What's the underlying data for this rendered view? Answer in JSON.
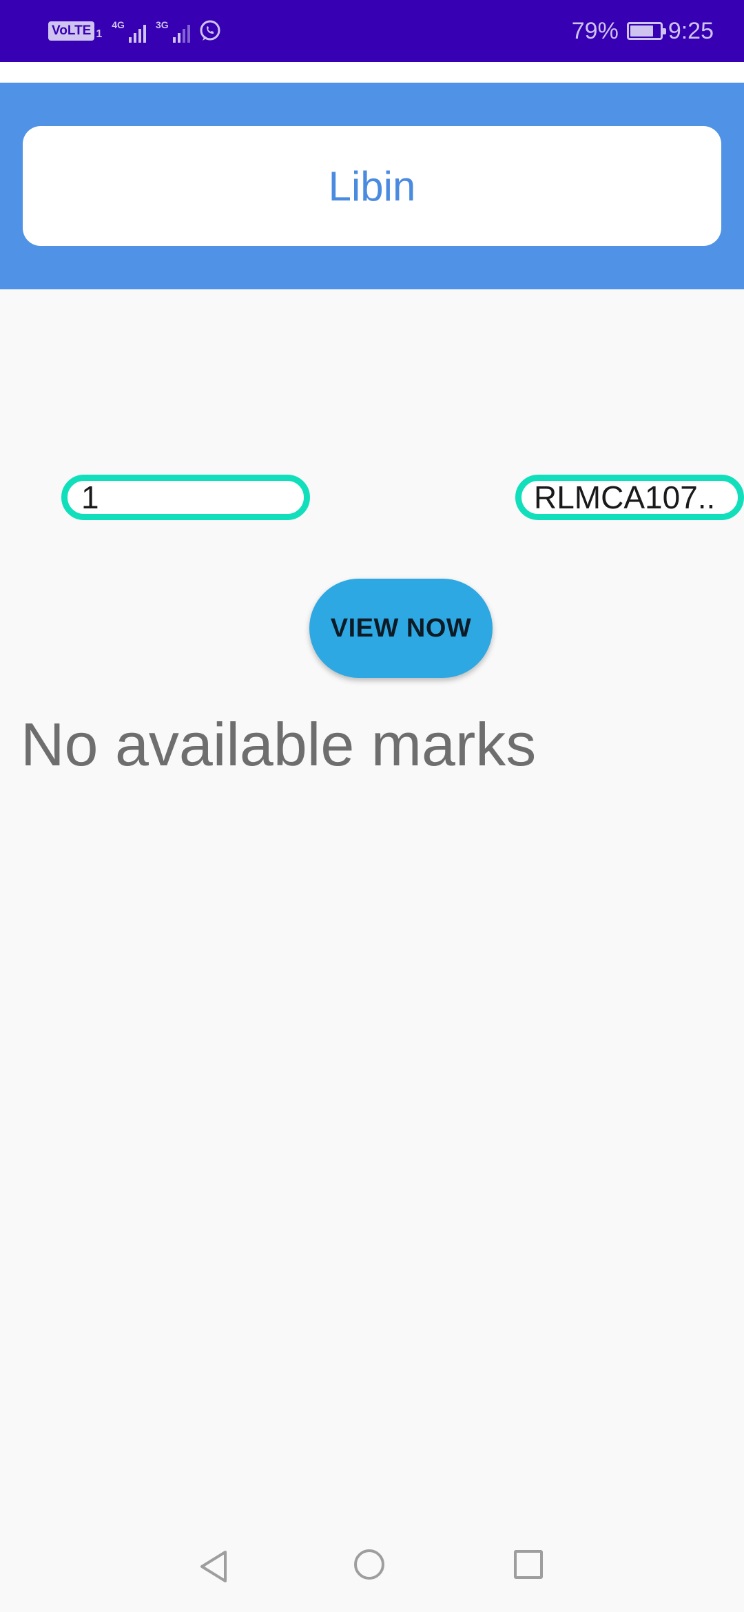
{
  "status_bar": {
    "volte_label": "VoLTE",
    "sim_number": "1",
    "network_1": "4G",
    "network_2": "3G",
    "battery_percent": "79%",
    "battery_level": 0.79,
    "time": "9:25",
    "background_color": "#3700b3",
    "icons": [
      "volte-icon",
      "signal-icon",
      "signal-icon",
      "whatsapp-icon",
      "battery-icon"
    ]
  },
  "header": {
    "name": "Libin",
    "background_color": "#5092e6"
  },
  "form": {
    "left_field_value": "1",
    "right_field_value": "RLMCA107..",
    "field_border_color": "#11dfbb"
  },
  "actions": {
    "view_button_label": "VIEW NOW",
    "button_color": "#2ea8e2"
  },
  "message": {
    "text": "No available marks"
  },
  "navigation": {
    "icons": [
      "back-icon",
      "home-icon",
      "recent-apps-icon"
    ]
  }
}
